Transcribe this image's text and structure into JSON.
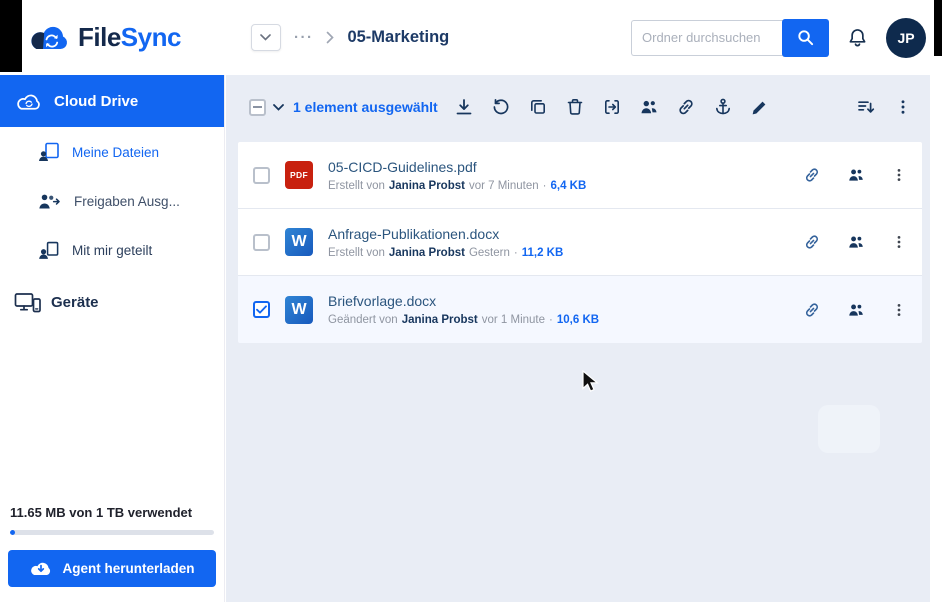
{
  "colors": {
    "accent": "#1266f1",
    "navy": "#14294b",
    "pdf_red": "#c8210f",
    "word_blue": "#185abd",
    "content_background": "#e9edf5",
    "selected_row_background": "#f5f8ff"
  },
  "header": {
    "logo_file": "File",
    "logo_sync": "Sync",
    "breadcrumb_ellipsis": "···",
    "breadcrumb_current": "05-Marketing",
    "search_placeholder": "Ordner durchsuchen",
    "avatar_initials": "JP"
  },
  "sidebar": {
    "items": [
      {
        "label": "Cloud Drive",
        "active": true,
        "icon": "cloud-icon"
      },
      {
        "label": "Meine Dateien",
        "icon": "my-files-icon"
      },
      {
        "label": "Freigaben Ausg...",
        "icon": "shared-out-icon"
      },
      {
        "label": "Mit mir geteilt",
        "icon": "shared-with-me-icon"
      },
      {
        "label": "Geräte",
        "icon": "devices-icon"
      }
    ],
    "storage_text": "11.65 MB von 1 TB verwendet",
    "storage_fill_style": "width:2.5%",
    "agent_button_label": "Agent herunterladen"
  },
  "toolbar": {
    "selection_label": "1 element ausgewählt",
    "icons": [
      "download",
      "version-restore",
      "copy",
      "delete",
      "move",
      "share",
      "link",
      "anchor",
      "rename"
    ],
    "right_icons": [
      "sort",
      "more-options"
    ]
  },
  "labels": {
    "separator": "·"
  },
  "file_icons": {
    "pdf_label": "PDF",
    "docx_label": "W"
  },
  "files": [
    {
      "name": "05-CICD-Guidelines.pdf",
      "file_type": "pdf",
      "meta_action": "Erstellt von",
      "meta_author": "Janina Probst",
      "meta_time": "vor 7 Minuten",
      "meta_size": "6,4 KB",
      "selected": false
    },
    {
      "name": "Anfrage-Publikationen.docx",
      "file_type": "docx",
      "meta_action": "Erstellt von",
      "meta_author": "Janina Probst",
      "meta_time": "Gestern",
      "meta_size": "11,2 KB",
      "selected": false
    },
    {
      "name": "Briefvorlage.docx",
      "file_type": "docx",
      "meta_action": "Geändert von",
      "meta_author": "Janina Probst",
      "meta_time": "vor 1 Minute",
      "meta_size": "10,6 KB",
      "selected": true
    }
  ]
}
